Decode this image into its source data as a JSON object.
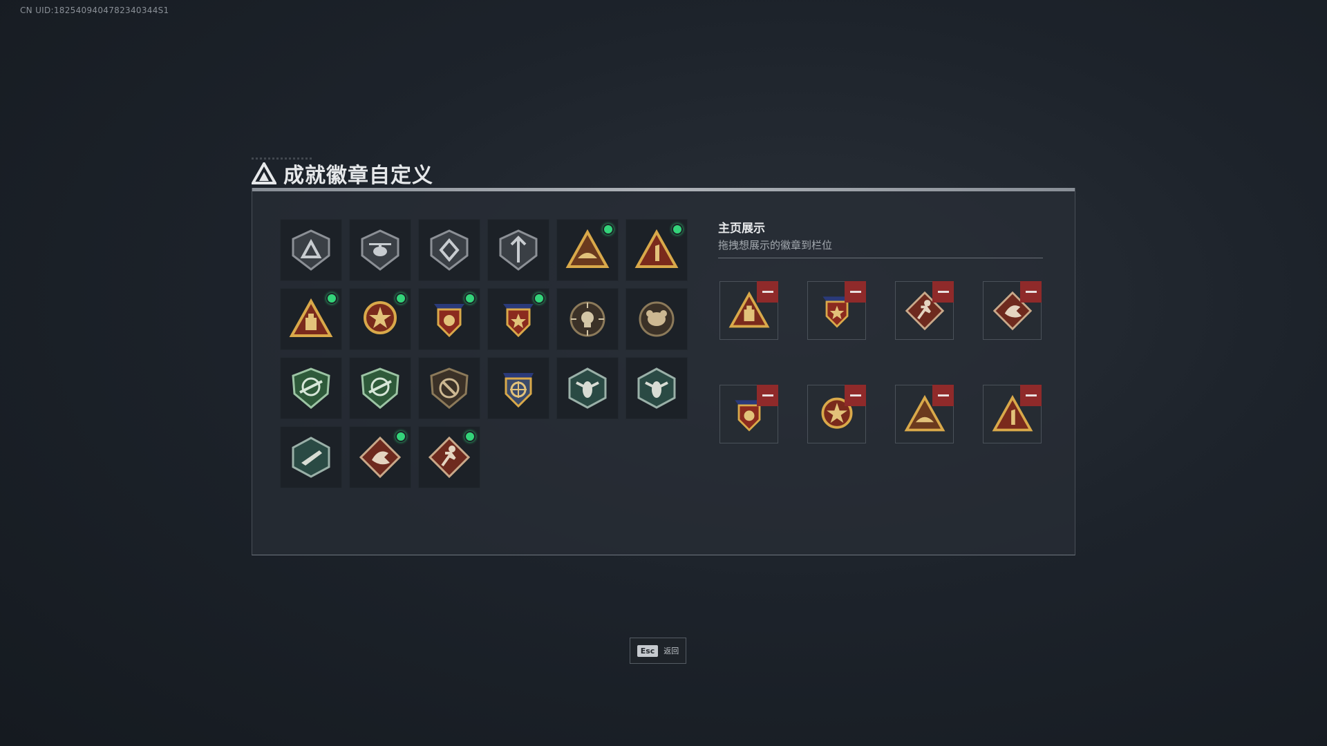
{
  "uid_text": "CN UID:1825409404782340344S1",
  "window": {
    "title": "成就徽章自定义",
    "logo_icon": "triangle-logo-icon"
  },
  "colors": {
    "accent_green": "#34d47a",
    "remove_red": "#8f2a2a"
  },
  "badges": [
    {
      "icon": "shield-triangle-icon",
      "new": false
    },
    {
      "icon": "helicopter-shield-icon",
      "new": false
    },
    {
      "icon": "diamond-shield-icon",
      "new": false
    },
    {
      "icon": "arrow-shield-icon",
      "new": false
    },
    {
      "icon": "golden-pyramid-icon",
      "new": true
    },
    {
      "icon": "number-one-triangle-icon",
      "new": true
    },
    {
      "icon": "ammo-triangle-icon",
      "new": true
    },
    {
      "icon": "star-medal-icon",
      "new": true
    },
    {
      "icon": "winged-medal-icon",
      "new": true
    },
    {
      "icon": "winged-star-medal-icon",
      "new": true
    },
    {
      "icon": "skull-crosshair-icon",
      "new": false
    },
    {
      "icon": "beast-round-icon",
      "new": false
    },
    {
      "icon": "green-rifle-shield-icon",
      "new": false
    },
    {
      "icon": "green-rifle-shield-icon",
      "new": false
    },
    {
      "icon": "knife-round-shield-icon",
      "new": false
    },
    {
      "icon": "golden-target-medal-icon",
      "new": false
    },
    {
      "icon": "wasp-hexagon-icon",
      "new": false
    },
    {
      "icon": "wasp-hexagon-icon",
      "new": false
    },
    {
      "icon": "gun-hexagon-icon",
      "new": false
    },
    {
      "icon": "dragon-diamond-icon",
      "new": true
    },
    {
      "icon": "runner-diamond-icon",
      "new": true
    }
  ],
  "showcase": {
    "title": "主页展示",
    "subtitle": "拖拽想展示的徽章到栏位",
    "slots": [
      {
        "icon": "ammo-triangle-icon",
        "remove_icon": "minus-icon"
      },
      {
        "icon": "winged-star-medal-icon",
        "remove_icon": "minus-icon"
      },
      {
        "icon": "runner-diamond-icon",
        "remove_icon": "minus-icon"
      },
      {
        "icon": "dragon-diamond-icon",
        "remove_icon": "minus-icon"
      },
      {
        "icon": "winged-medal-icon",
        "remove_icon": "minus-icon"
      },
      {
        "icon": "star-medal-icon",
        "remove_icon": "minus-icon"
      },
      {
        "icon": "golden-pyramid-icon",
        "remove_icon": "minus-icon"
      },
      {
        "icon": "number-one-triangle-icon",
        "remove_icon": "minus-icon"
      }
    ]
  },
  "footer": {
    "key": "Esc",
    "label": "返回"
  }
}
